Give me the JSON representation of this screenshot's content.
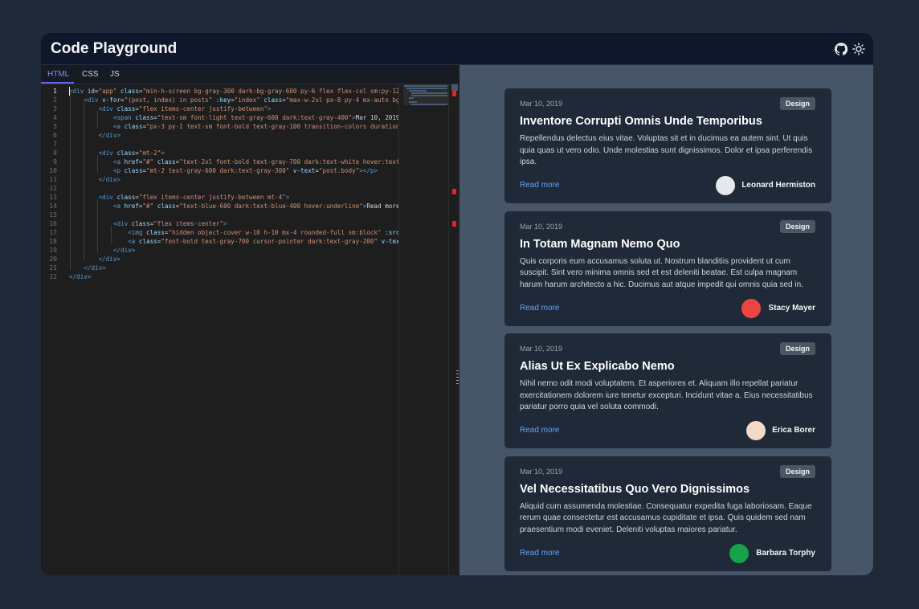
{
  "app": {
    "title": "Code Playground"
  },
  "header": {
    "icons": [
      "github-icon",
      "sun-icon"
    ]
  },
  "editor": {
    "tabs": [
      {
        "label": "HTML",
        "active": true
      },
      {
        "label": "CSS",
        "active": false
      },
      {
        "label": "JS",
        "active": false
      }
    ],
    "line_numbers": [
      "1",
      "2",
      "3",
      "4",
      "5",
      "6",
      "7",
      "8",
      "9",
      "10",
      "11",
      "12",
      "13",
      "14",
      "15",
      "16",
      "17",
      "18",
      "19",
      "20",
      "21",
      "22"
    ],
    "code_lines": [
      [
        [
          "tag",
          "<div "
        ],
        [
          "attr",
          "id"
        ],
        [
          "txt",
          "="
        ],
        [
          "str",
          "\"app\" "
        ],
        [
          "attr",
          "class"
        ],
        [
          "txt",
          "="
        ],
        [
          "str",
          "\"min-h-screen bg-gray-300 dark:bg-gray-600 py-6 flex flex-col sm:py-12 spa"
        ]
      ],
      [
        [
          "txt",
          "    "
        ],
        [
          "tag",
          "<div "
        ],
        [
          "attr",
          "v-for"
        ],
        [
          "txt",
          "="
        ],
        [
          "str",
          "\"(post, index) in posts\" "
        ],
        [
          "attr",
          ":key"
        ],
        [
          "txt",
          "="
        ],
        [
          "str",
          "\"index\" "
        ],
        [
          "attr",
          "class"
        ],
        [
          "txt",
          "="
        ],
        [
          "str",
          "\"max-w-2xl px-8 py-4 mx-auto bg-whi"
        ]
      ],
      [
        [
          "txt",
          "        "
        ],
        [
          "tag",
          "<div "
        ],
        [
          "attr",
          "class"
        ],
        [
          "txt",
          "="
        ],
        [
          "str",
          "\"flex items-center justify-between\""
        ],
        [
          "tag",
          ">"
        ]
      ],
      [
        [
          "txt",
          "            "
        ],
        [
          "tag",
          "<span "
        ],
        [
          "attr",
          "class"
        ],
        [
          "txt",
          "="
        ],
        [
          "str",
          "\"text-sm font-light text-gray-600 dark:text-gray-400\""
        ],
        [
          "tag",
          ">"
        ],
        [
          "txt",
          "Mar 10, 2019"
        ],
        [
          "tag",
          "</spa"
        ]
      ],
      [
        [
          "txt",
          "            "
        ],
        [
          "tag",
          "<a "
        ],
        [
          "attr",
          "class"
        ],
        [
          "txt",
          "="
        ],
        [
          "str",
          "\"px-3 py-1 text-sm font-bold text-gray-100 transition-colors duration-200"
        ]
      ],
      [
        [
          "txt",
          "        "
        ],
        [
          "tag",
          "</div>"
        ]
      ],
      [
        [
          "txt",
          ""
        ]
      ],
      [
        [
          "txt",
          "        "
        ],
        [
          "tag",
          "<div "
        ],
        [
          "attr",
          "class"
        ],
        [
          "txt",
          "="
        ],
        [
          "str",
          "\"mt-2\""
        ],
        [
          "tag",
          ">"
        ]
      ],
      [
        [
          "txt",
          "            "
        ],
        [
          "tag",
          "<a "
        ],
        [
          "attr",
          "href"
        ],
        [
          "txt",
          "="
        ],
        [
          "str",
          "\"#\" "
        ],
        [
          "attr",
          "class"
        ],
        [
          "txt",
          "="
        ],
        [
          "str",
          "\"text-2xl font-bold text-gray-700 dark:text-white hover:text-gra"
        ]
      ],
      [
        [
          "txt",
          "            "
        ],
        [
          "tag",
          "<p "
        ],
        [
          "attr",
          "class"
        ],
        [
          "txt",
          "="
        ],
        [
          "str",
          "\"mt-2 text-gray-600 dark:text-gray-300\" "
        ],
        [
          "attr",
          "v-text"
        ],
        [
          "txt",
          "="
        ],
        [
          "str",
          "\"post.body\""
        ],
        [
          "tag",
          "></p>"
        ]
      ],
      [
        [
          "txt",
          "        "
        ],
        [
          "tag",
          "</div>"
        ]
      ],
      [
        [
          "txt",
          ""
        ]
      ],
      [
        [
          "txt",
          "        "
        ],
        [
          "tag",
          "<div "
        ],
        [
          "attr",
          "class"
        ],
        [
          "txt",
          "="
        ],
        [
          "str",
          "\"flex items-center justify-between mt-4\""
        ],
        [
          "tag",
          ">"
        ]
      ],
      [
        [
          "txt",
          "            "
        ],
        [
          "tag",
          "<a "
        ],
        [
          "attr",
          "href"
        ],
        [
          "txt",
          "="
        ],
        [
          "str",
          "\"#\" "
        ],
        [
          "attr",
          "class"
        ],
        [
          "txt",
          "="
        ],
        [
          "str",
          "\"text-blue-600 dark:text-blue-400 hover:underline\""
        ],
        [
          "tag",
          ">"
        ],
        [
          "txt",
          "Read more"
        ],
        [
          "tag",
          "</a"
        ]
      ],
      [
        [
          "txt",
          ""
        ]
      ],
      [
        [
          "txt",
          "            "
        ],
        [
          "tag",
          "<div "
        ],
        [
          "attr",
          "class"
        ],
        [
          "txt",
          "="
        ],
        [
          "str",
          "\"flex items-center\""
        ],
        [
          "tag",
          ">"
        ]
      ],
      [
        [
          "txt",
          "                "
        ],
        [
          "tag",
          "<img "
        ],
        [
          "attr",
          "class"
        ],
        [
          "txt",
          "="
        ],
        [
          "str",
          "\"hidden object-cover w-10 h-10 mx-4 rounded-full sm:block\" "
        ],
        [
          "attr",
          ":src"
        ],
        [
          "txt",
          "="
        ],
        [
          "str",
          "\"po"
        ]
      ],
      [
        [
          "txt",
          "                "
        ],
        [
          "tag",
          "<a "
        ],
        [
          "attr",
          "class"
        ],
        [
          "txt",
          "="
        ],
        [
          "str",
          "\"font-bold text-gray-700 cursor-pointer dark:text-gray-200\" "
        ],
        [
          "attr",
          "v-text"
        ],
        [
          "txt",
          "="
        ],
        [
          "str",
          "\"p"
        ]
      ],
      [
        [
          "txt",
          "            "
        ],
        [
          "tag",
          "</div>"
        ]
      ],
      [
        [
          "txt",
          "        "
        ],
        [
          "tag",
          "</div>"
        ]
      ],
      [
        [
          "txt",
          "    "
        ],
        [
          "tag",
          "</div>"
        ]
      ],
      [
        [
          "tag",
          "</div>"
        ]
      ]
    ]
  },
  "preview": {
    "cards": [
      {
        "date": "Mar 10, 2019",
        "badge": "Design",
        "title": "Inventore Corrupti Omnis Unde Temporibus",
        "body": "Repellendus delectus eius vitae. Voluptas sit et in ducimus ea autem sint. Ut quis quia quas ut vero odio. Unde molestias sunt dignissimos. Dolor et ipsa perferendis ipsa.",
        "read_more": "Read more",
        "author": "Leonard Hermiston",
        "avatar_color": "#e5e7eb"
      },
      {
        "date": "Mar 10, 2019",
        "badge": "Design",
        "title": "In Totam Magnam Nemo Quo",
        "body": "Quis corporis eum accusamus soluta ut. Nostrum blanditiis provident ut cum suscipit. Sint vero minima omnis sed et est deleniti beatae. Est culpa magnam harum harum architecto a hic. Ducimus aut atque impedit qui omnis quia sed in.",
        "read_more": "Read more",
        "author": "Stacy Mayer",
        "avatar_color": "#ef4444"
      },
      {
        "date": "Mar 10, 2019",
        "badge": "Design",
        "title": "Alias Ut Ex Explicabo Nemo",
        "body": "Nihil nemo odit modi voluptatem. Et asperiores et. Aliquam illo repellat pariatur exercitationem dolorem iure tenetur excepturi. Incidunt vitae a. Eius necessitatibus pariatur porro quia vel soluta commodi.",
        "read_more": "Read more",
        "author": "Erica Borer",
        "avatar_color": "#f3d9c9"
      },
      {
        "date": "Mar 10, 2019",
        "badge": "Design",
        "title": "Vel Necessitatibus Quo Vero Dignissimos",
        "body": "Aliquid cum assumenda molestiae. Consequatur expedita fuga laboriosam. Eaque rerum quae consectetur est accusamus cupiditate et ipsa. Quis quidem sed nam praesentium modi eveniet. Deleniti voluptas maiores pariatur.",
        "read_more": "Read more",
        "author": "Barbara Torphy",
        "avatar_color": "#16a34a"
      }
    ]
  },
  "colors": {
    "accent": "#6366f1",
    "link": "#60a5fa",
    "error_marker": "#dc2626",
    "card_bg": "#1f2937",
    "preview_bg": "#475569"
  }
}
